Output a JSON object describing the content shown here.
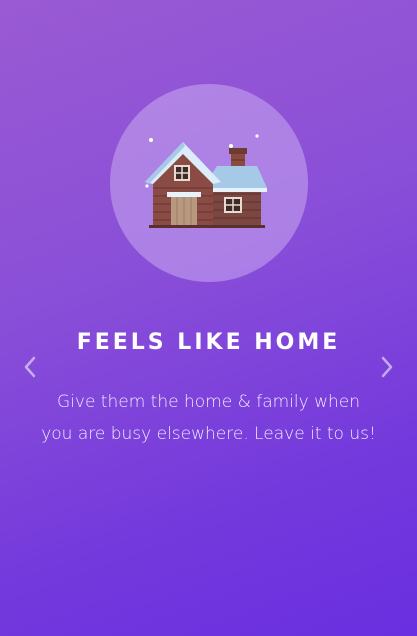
{
  "slide": {
    "title": "FEELS LIKE HOME",
    "description": "Give them the home & family when you are busy elsewhere. Leave it to us!",
    "illustration_icon": "snowy-house-icon"
  },
  "navigation": {
    "prev_icon": "chevron-left-icon",
    "next_icon": "chevron-right-icon"
  },
  "colors": {
    "background_start": "#9a5ad3",
    "background_end": "#6a2fe0",
    "circle": "#c8aaf0",
    "text": "#ffffff"
  }
}
